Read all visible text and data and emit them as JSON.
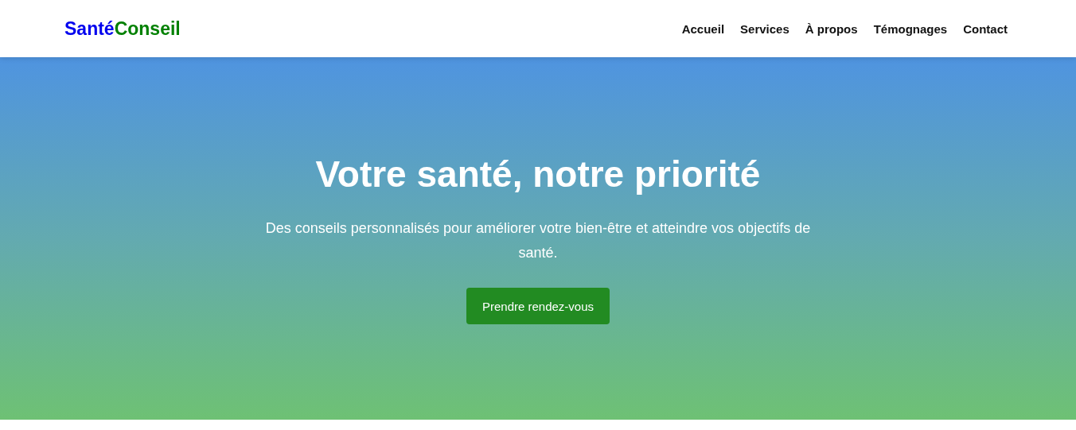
{
  "header": {
    "logo": [
      {
        "text": "Santé",
        "color": "#0000ee"
      },
      {
        "text": "Conseil",
        "color": "#008000"
      }
    ],
    "nav": [
      {
        "label": "Accueil"
      },
      {
        "label": "Services"
      },
      {
        "label": "À propos"
      },
      {
        "label": "Témognages"
      },
      {
        "label": "Contact"
      }
    ]
  },
  "hero": {
    "title": "Votre santé, notre priorité",
    "subtitle": "Des conseils personnalisés pour améliorer votre bien-être et atteindre vos objectifs de santé.",
    "button": "Prendre rendez-vous"
  }
}
